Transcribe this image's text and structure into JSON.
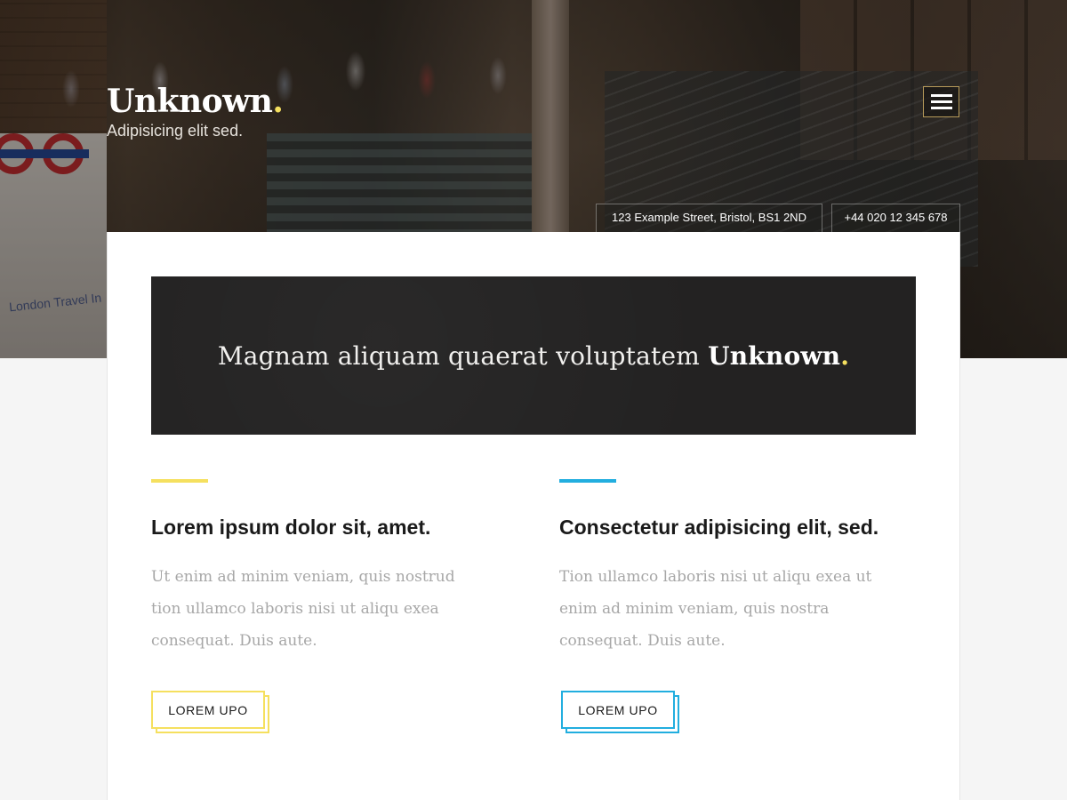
{
  "colors": {
    "accent_yellow": "#f5e05f",
    "accent_blue": "#22aedf",
    "banner_bg": "#232222",
    "page_bg": "#f5f5f5",
    "card_bg": "#ffffff"
  },
  "header": {
    "brand_name": "Unknown",
    "brand_dot": ".",
    "tagline": "Adipisicing elit sed.",
    "menu_icon": "hamburger-menu-icon"
  },
  "contact": {
    "address": "123 Example Street, Bristol, BS1 2ND",
    "phone": "+44 020 12 345 678"
  },
  "hero": {
    "sign_text": "London Travel In"
  },
  "banner": {
    "text_prefix": "Magnam aliquam quaerat voluptatem",
    "text_strong": "Unknown",
    "text_dot": "."
  },
  "features": [
    {
      "heading": "Lorem ipsum dolor sit, amet.",
      "body": "Ut enim ad minim veniam, quis nostrud tion ullamco laboris nisi ut aliqu exea consequat. Duis aute.",
      "button_label": "LOREM UPO",
      "accent": "yellow"
    },
    {
      "heading": "Consectetur adipisicing elit, sed.",
      "body": "Tion ullamco laboris nisi ut aliqu exea ut enim ad minim veniam, quis nostra consequat. Duis aute.",
      "button_label": "LOREM UPO",
      "accent": "blue"
    }
  ]
}
